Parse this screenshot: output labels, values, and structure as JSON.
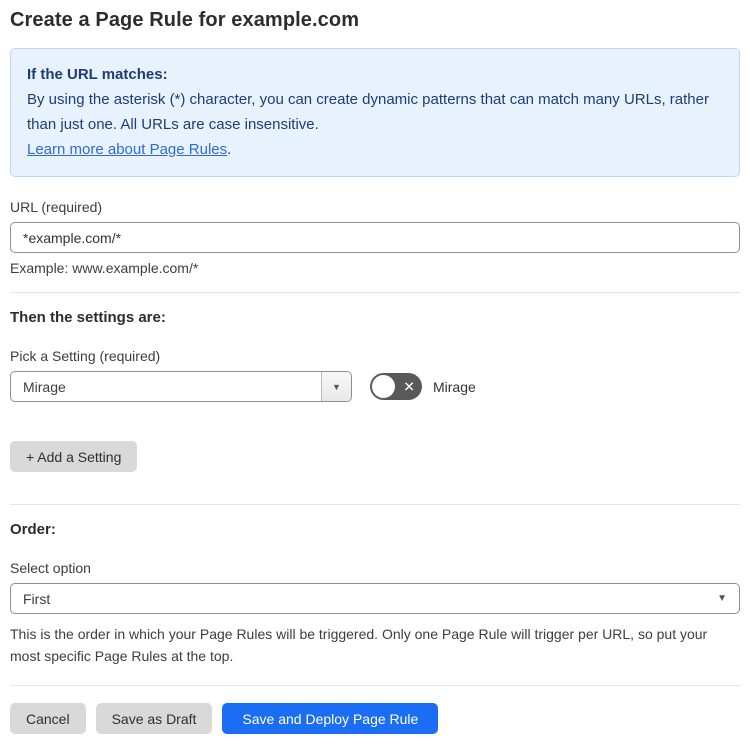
{
  "page_title": "Create a Page Rule for example.com",
  "info_box": {
    "heading": "If the URL matches:",
    "body": "By using the asterisk (*) character, you can create dynamic patterns that can match many URLs, rather than just one. All URLs are case insensitive.",
    "link_text": "Learn more about Page Rules",
    "link_suffix": "."
  },
  "url_field": {
    "label": "URL (required)",
    "value": "*example.com/*",
    "example": "Example: www.example.com/*"
  },
  "settings_section": {
    "heading": "Then the settings are:",
    "pick_setting_label": "Pick a Setting (required)",
    "selected_setting": "Mirage",
    "toggle_label": "Mirage",
    "toggle_state": "off",
    "add_setting_button": "+ Add a Setting"
  },
  "order_section": {
    "heading": "Order:",
    "select_label": "Select option",
    "selected_option": "First",
    "help_text": "This is the order in which your Page Rules will be triggered. Only one Page Rule will trigger per URL, so put your most specific Page Rules at the top."
  },
  "footer": {
    "cancel_label": "Cancel",
    "save_draft_label": "Save as Draft",
    "save_deploy_label": "Save and Deploy Page Rule"
  },
  "icons": {
    "dropdown_arrow": "▼",
    "toggle_off_x": "✕"
  },
  "colors": {
    "primary_blue": "#1b6ef3",
    "info_bg": "#e8f2fc",
    "info_border": "#bcd7f5",
    "info_text": "#1e3c78",
    "link_blue": "#2f6bd8",
    "toggle_off_bg": "#595959",
    "gray_button_bg": "#d9d9d9",
    "input_border": "#8e8e8e"
  }
}
